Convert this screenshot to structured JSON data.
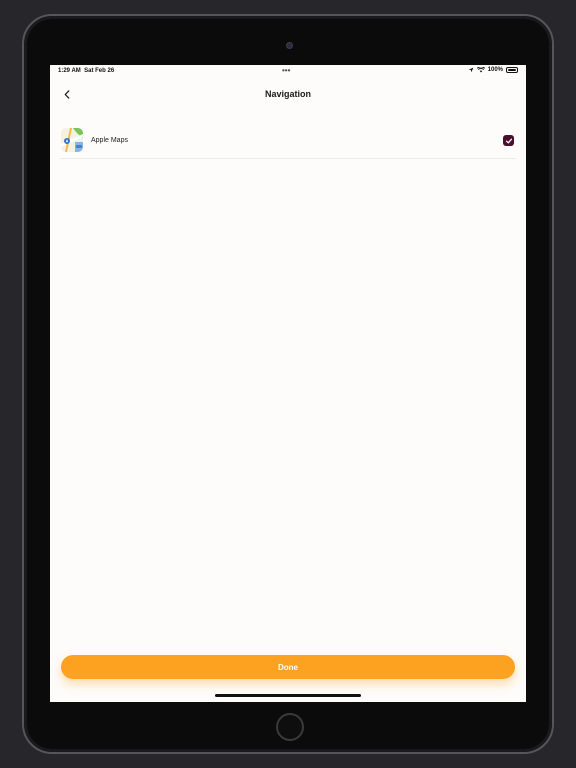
{
  "status_bar": {
    "time": "1:29 AM",
    "date": "Sat Feb 26",
    "battery": "100%"
  },
  "header": {
    "title": "Navigation"
  },
  "options": [
    {
      "label": "Apple Maps",
      "checked": true,
      "icon": "apple-maps-icon"
    }
  ],
  "footer": {
    "done_label": "Done"
  },
  "colors": {
    "accent": "#fca120",
    "check": "#4b0f2c",
    "background": "#fdfcfa"
  }
}
